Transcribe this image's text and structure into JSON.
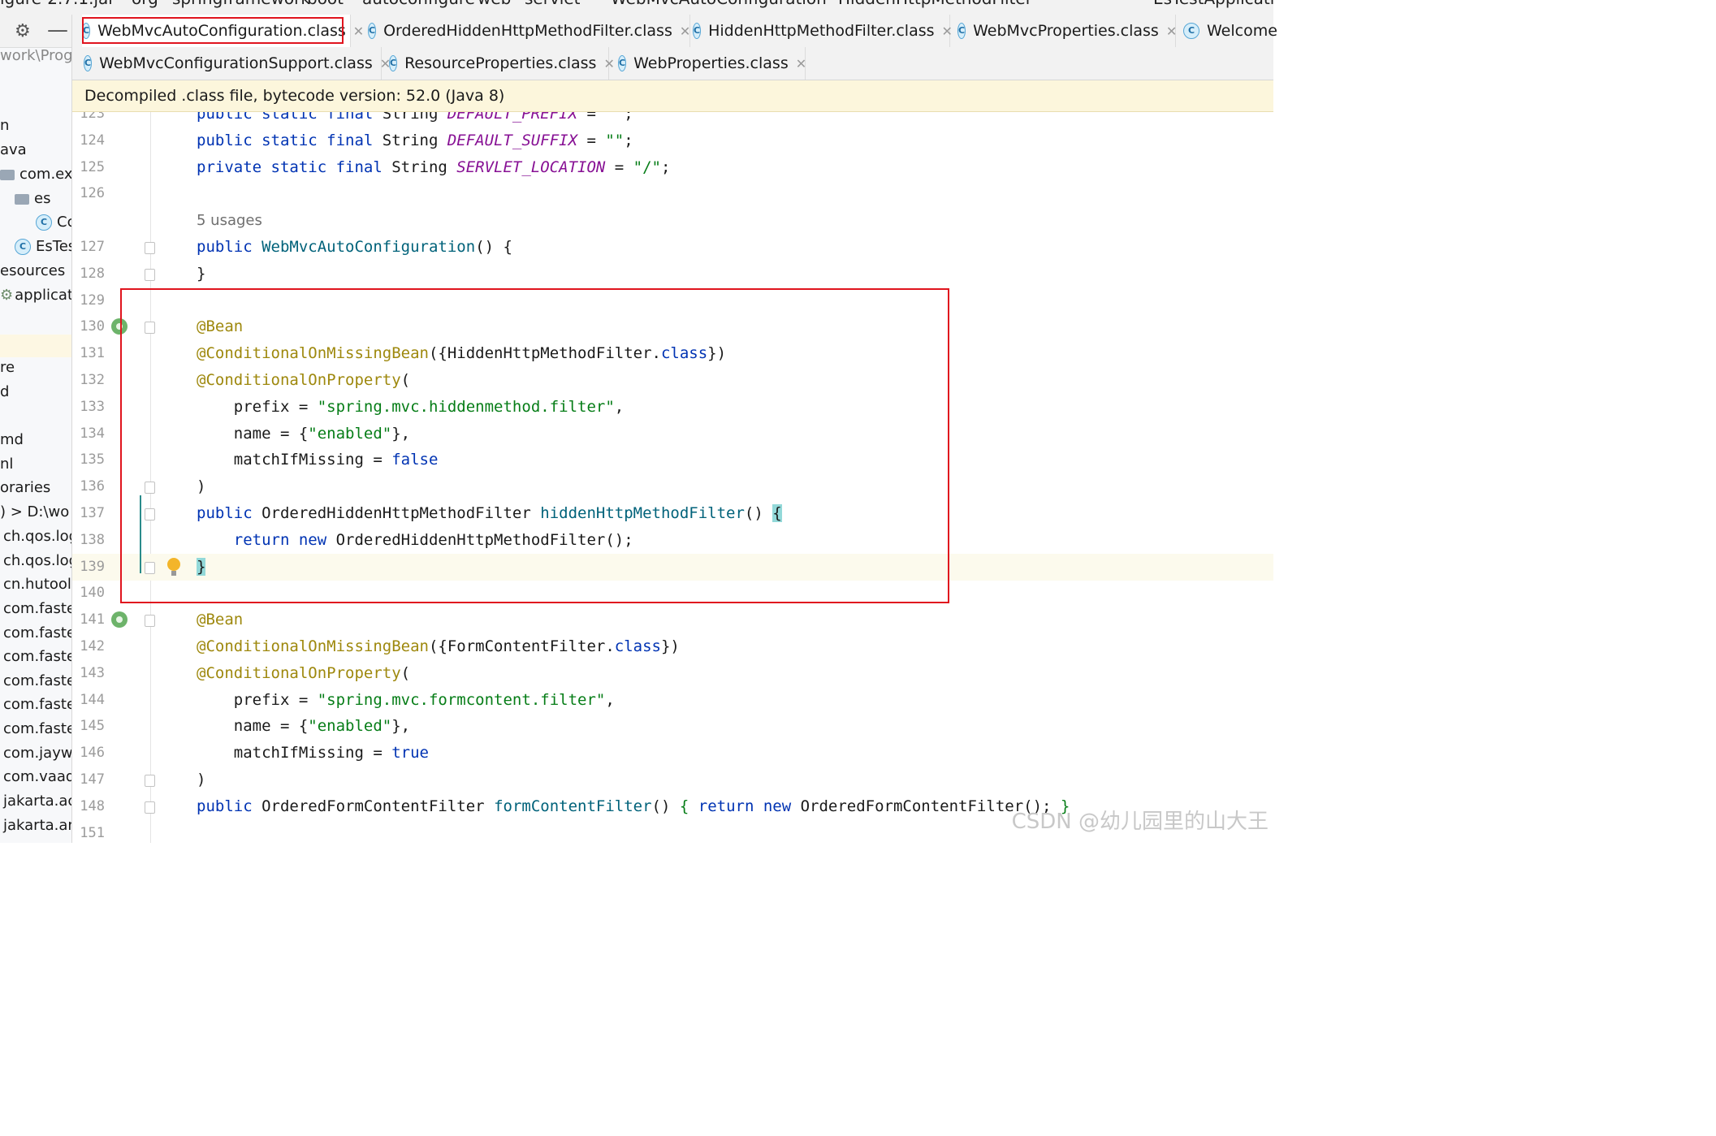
{
  "top_path": {
    "items": [
      "igure-2.7.1.jar",
      "org",
      "springframework",
      "boot",
      "autoconfigure",
      "web",
      "servlet",
      "WebMvcAutoConfiguration",
      "HiddenHttpMethodFilter"
    ],
    "run_config": "EsTestApplication"
  },
  "sidebar": {
    "rows": [
      {
        "text": "work\\Prog",
        "muted": true
      },
      {
        "text": "n"
      },
      {
        "text": "ava"
      },
      {
        "text": "com.exa",
        "icon": "folder"
      },
      {
        "text": "es",
        "icon": "folder"
      },
      {
        "text": "Cc",
        "icon": "class"
      },
      {
        "text": "EsTes",
        "icon": "class"
      },
      {
        "text": "esources"
      },
      {
        "text": "applicati",
        "icon": "settings"
      },
      {
        "text": "re"
      },
      {
        "text": "d"
      },
      {
        "text": "md"
      },
      {
        "text": "nl"
      },
      {
        "text": "oraries"
      },
      {
        "text": ") >  D:\\wo"
      },
      {
        "text": "ch.qos.log"
      },
      {
        "text": "ch.qos.log"
      },
      {
        "text": "cn.hutool:"
      },
      {
        "text": "com.faster"
      },
      {
        "text": "com.faster"
      },
      {
        "text": "com.faster"
      },
      {
        "text": "com.faster"
      },
      {
        "text": "com.faster"
      },
      {
        "text": "com.faster"
      },
      {
        "text": "com.jaywa"
      },
      {
        "text": "com.vaadi"
      },
      {
        "text": "jakarta.act"
      },
      {
        "text": "jakarta.an"
      }
    ]
  },
  "tabs_row1": [
    {
      "label": "WebMvcAutoConfiguration.class",
      "active": true
    },
    {
      "label": "OrderedHiddenHttpMethodFilter.class"
    },
    {
      "label": "HiddenHttpMethodFilter.class"
    },
    {
      "label": "WebMvcProperties.class"
    },
    {
      "label": "Welcome"
    }
  ],
  "tabs_row2": [
    {
      "label": "WebMvcConfigurationSupport.class"
    },
    {
      "label": "ResourceProperties.class"
    },
    {
      "label": "WebProperties.class"
    }
  ],
  "banner": "Decompiled .class file, bytecode version: 52.0 (Java 8)",
  "editor": {
    "lines": [
      {
        "n": "123",
        "html": "<span class='kw'>public static final</span> String <span class='const'>DEFAULT_PREFIX</span> = <span class='str'>\"\"</span>;",
        "partial": true
      },
      {
        "n": "124",
        "html": "<span class='kw'>public static final</span> String <span class='const'>DEFAULT_SUFFIX</span> = <span class='str'>\"\"</span>;"
      },
      {
        "n": "125",
        "html": "<span class='kw'>private static final</span> String <span class='const'>SERVLET_LOCATION</span> = <span class='str'>\"/\"</span>;"
      },
      {
        "n": "126",
        "html": ""
      },
      {
        "hint": "5 usages"
      },
      {
        "n": "127",
        "html": "<span class='kw'>public</span> <span class='fn'>WebMvcAutoConfiguration</span>() {",
        "fold": true
      },
      {
        "n": "128",
        "html": "}",
        "fold": true
      },
      {
        "n": "129",
        "html": ""
      },
      {
        "n": "130",
        "html": "<span class='ann'>@Bean</span>",
        "bean": true,
        "fold": true
      },
      {
        "n": "131",
        "html": "<span class='ann'>@ConditionalOnMissingBean</span>({HiddenHttpMethodFilter.<span class='kw'>class</span>})"
      },
      {
        "n": "132",
        "html": "<span class='ann'>@ConditionalOnProperty</span>("
      },
      {
        "n": "133",
        "html": "    prefix = <span class='str'>\"spring.mvc.hiddenmethod.filter\"</span>,"
      },
      {
        "n": "134",
        "html": "    name = {<span class='str'>\"enabled\"</span>},"
      },
      {
        "n": "135",
        "html": "    matchIfMissing = <span class='kw'>false</span>"
      },
      {
        "n": "136",
        "html": ")",
        "fold": true
      },
      {
        "n": "137",
        "html": "<span class='kw'>public</span> OrderedHiddenHttpMethodFilter <span class='fn'>hiddenHttpMethodFilter</span>() <span class='brace-hl'>{</span>",
        "fold": true
      },
      {
        "n": "138",
        "html": "    <span class='kw'>return new</span> OrderedHiddenHttpMethodFilter();"
      },
      {
        "n": "139",
        "html": "<span class='brace-hl'>}</span>",
        "fold": true,
        "bulb": true,
        "current": true
      },
      {
        "n": "140",
        "html": ""
      },
      {
        "n": "141",
        "html": "<span class='ann'>@Bean</span>",
        "bean": true,
        "fold": true
      },
      {
        "n": "142",
        "html": "<span class='ann'>@ConditionalOnMissingBean</span>({FormContentFilter.<span class='kw'>class</span>})"
      },
      {
        "n": "143",
        "html": "<span class='ann'>@ConditionalOnProperty</span>("
      },
      {
        "n": "144",
        "html": "    prefix = <span class='str'>\"spring.mvc.formcontent.filter\"</span>,"
      },
      {
        "n": "145",
        "html": "    name = {<span class='str'>\"enabled\"</span>},"
      },
      {
        "n": "146",
        "html": "    matchIfMissing = <span class='kw'>true</span>"
      },
      {
        "n": "147",
        "html": ")",
        "fold": true
      },
      {
        "n": "148",
        "html": "<span class='kw'>public</span> OrderedFormContentFilter <span class='fn'>formContentFilter</span>() <span style='color:#067d17'>{</span> <span class='kw'>return new</span> OrderedFormContentFilter(); <span style='color:#067d17'>}</span>",
        "fold": true
      },
      {
        "n": "151",
        "html": ""
      }
    ]
  },
  "watermark": "CSDN @幼儿园里的山大王"
}
